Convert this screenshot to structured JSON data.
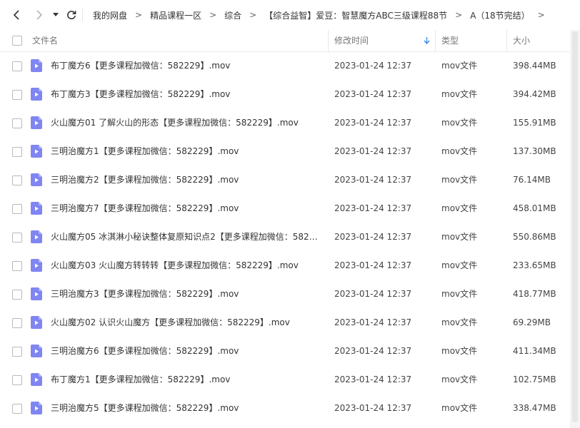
{
  "breadcrumb": [
    "我的网盘",
    "精品课程一区",
    "综合",
    "【综合益智】爱豆：智慧魔方ABC三级课程88节",
    "A（18节完结）"
  ],
  "crumb_separator": ">",
  "columns": {
    "name": "文件名",
    "modified": "修改时间",
    "type": "类型",
    "size": "大小"
  },
  "files": [
    {
      "name": "布丁魔方6【更多课程加微信：582229】.mov",
      "modified": "2023-01-24 12:37",
      "type": "mov文件",
      "size": "398.44MB"
    },
    {
      "name": "布丁魔方3【更多课程加微信：582229】.mov",
      "modified": "2023-01-24 12:37",
      "type": "mov文件",
      "size": "394.42MB"
    },
    {
      "name": "火山魔方01 了解火山的形态【更多课程加微信：582229】.mov",
      "modified": "2023-01-24 12:37",
      "type": "mov文件",
      "size": "155.91MB"
    },
    {
      "name": "三明治魔方1【更多课程加微信：582229】.mov",
      "modified": "2023-01-24 12:37",
      "type": "mov文件",
      "size": "137.30MB"
    },
    {
      "name": "三明治魔方2【更多课程加微信：582229】.mov",
      "modified": "2023-01-24 12:37",
      "type": "mov文件",
      "size": "76.14MB"
    },
    {
      "name": "三明治魔方7【更多课程加微信：582229】.mov",
      "modified": "2023-01-24 12:37",
      "type": "mov文件",
      "size": "458.01MB"
    },
    {
      "name": "火山魔方05 冰淇淋小秘诀整体复原知识点2【更多课程加微信：5822...",
      "modified": "2023-01-24 12:37",
      "type": "mov文件",
      "size": "550.86MB"
    },
    {
      "name": "火山魔方03 火山魔方转转转【更多课程加微信：582229】.mov",
      "modified": "2023-01-24 12:37",
      "type": "mov文件",
      "size": "233.65MB"
    },
    {
      "name": "三明治魔方3【更多课程加微信：582229】.mov",
      "modified": "2023-01-24 12:37",
      "type": "mov文件",
      "size": "418.77MB"
    },
    {
      "name": "火山魔方02 认识火山魔方【更多课程加微信：582229】.mov",
      "modified": "2023-01-24 12:37",
      "type": "mov文件",
      "size": "69.29MB"
    },
    {
      "name": "三明治魔方6【更多课程加微信：582229】.mov",
      "modified": "2023-01-24 12:37",
      "type": "mov文件",
      "size": "411.34MB"
    },
    {
      "name": "布丁魔方1【更多课程加微信：582229】.mov",
      "modified": "2023-01-24 12:37",
      "type": "mov文件",
      "size": "102.75MB"
    },
    {
      "name": "三明治魔方5【更多课程加微信：582229】.mov",
      "modified": "2023-01-24 12:37",
      "type": "mov文件",
      "size": "338.47MB"
    }
  ],
  "icons": {
    "back": "chevron-left-icon",
    "forward": "chevron-right-icon",
    "history": "caret-down-icon",
    "refresh": "refresh-icon",
    "sort": "arrow-down-icon",
    "file": "video-file-icon"
  },
  "colors": {
    "file_icon": "#7f86f2",
    "sort_arrow": "#3b8beb"
  }
}
